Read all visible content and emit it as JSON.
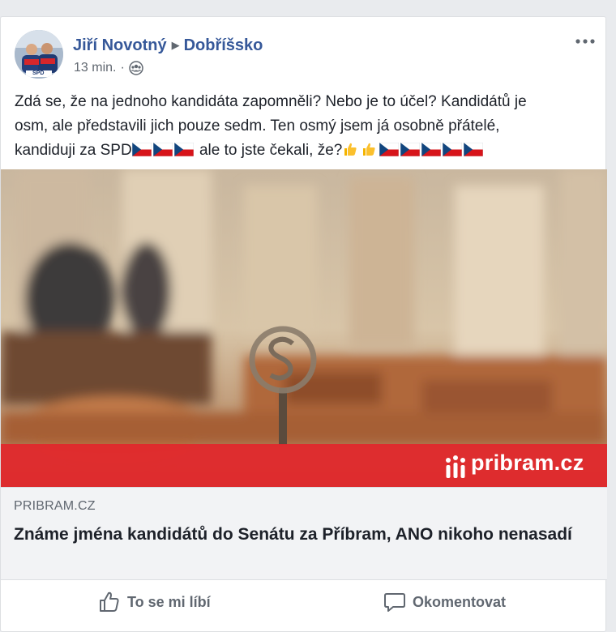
{
  "post": {
    "author": "Jiří Novotný",
    "group": "Dobříšsko",
    "time": "13 min.",
    "separator": "·",
    "text_line1": "Zdá se, že na jednoho kandidáta zapomněli? Nebo je to účel? Kandidátů je",
    "text_line2": "osm, ale představili jich pouze sedm. Ten osmý jsem já osobně přátelé,",
    "text_line3_a": "kandiduji za SPD",
    "text_line3_b": " ale to jste čekali, že?",
    "avatar_text": "SPD"
  },
  "link": {
    "image_brand": "pribram.cz",
    "domain": "PRIBRAM.CZ",
    "title": "Známe jména kandidátů do Senátu za Příbram, ANO nikoho nenasadí"
  },
  "actions": {
    "like_label": "To se mi líbí",
    "comment_label": "Okomentovat"
  },
  "icons": {
    "privacy": "group-icon",
    "more": "more-options-icon",
    "like": "thumbs-up-icon",
    "comment": "comment-bubble-icon",
    "flag": "czech-flag-icon",
    "emoji": "thumbs-up-emoji-icon"
  },
  "colors": {
    "author": "#365899",
    "text": "#1d2129",
    "secondary": "#606770",
    "brand_banner": "#e2262b"
  }
}
